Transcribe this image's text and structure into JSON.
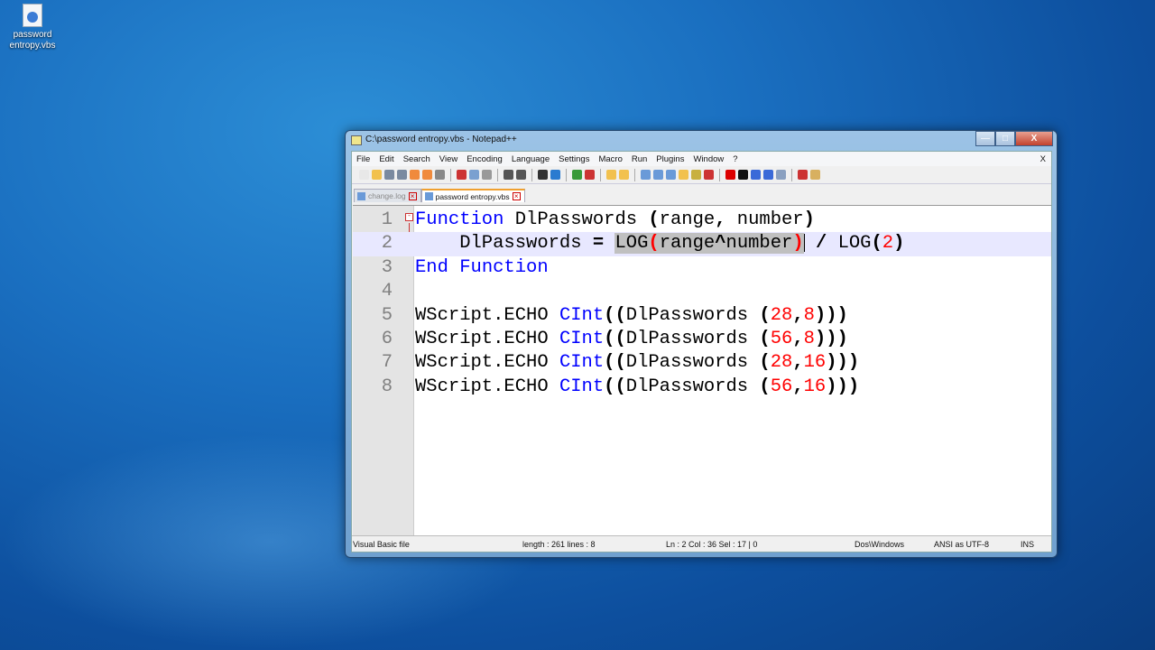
{
  "desktop": {
    "icons": [
      {
        "label_line1": "password",
        "label_line2": "entropy.vbs"
      }
    ]
  },
  "window": {
    "title": "C:\\password entropy.vbs - Notepad++",
    "minimize": "—",
    "maximize": "□",
    "close": "X"
  },
  "menu": [
    "File",
    "Edit",
    "Search",
    "View",
    "Encoding",
    "Language",
    "Settings",
    "Macro",
    "Run",
    "Plugins",
    "Window",
    "?"
  ],
  "menu_close": "X",
  "tabs": [
    {
      "label": "change.log",
      "active": false
    },
    {
      "label": "password entropy.vbs",
      "active": true
    }
  ],
  "code": [
    {
      "n": "1",
      "tokens": [
        [
          "Function",
          "kw"
        ],
        [
          " DlPasswords ",
          ""
        ],
        [
          "(",
          "op"
        ],
        [
          "range",
          ""
        ],
        [
          ",",
          "op"
        ],
        [
          " number",
          ""
        ],
        [
          ")",
          "op"
        ]
      ]
    },
    {
      "n": "2",
      "tokens": [
        [
          "    DlPasswords ",
          ""
        ],
        [
          "=",
          "op"
        ],
        [
          " ",
          ""
        ],
        [
          "LOG",
          "sel"
        ],
        [
          "(",
          "sel brace"
        ],
        [
          "range",
          "sel"
        ],
        [
          "^",
          "sel op"
        ],
        [
          "number",
          "sel"
        ],
        [
          ")",
          "sel brace"
        ],
        [
          "|",
          "caret"
        ],
        [
          " ",
          ""
        ],
        [
          "/",
          "op"
        ],
        [
          " LOG",
          ""
        ],
        [
          "(",
          "op"
        ],
        [
          "2",
          "num"
        ],
        [
          ")",
          "op"
        ]
      ]
    },
    {
      "n": "3",
      "tokens": [
        [
          "End",
          "kw"
        ],
        [
          " ",
          ""
        ],
        [
          "Function",
          "kw"
        ]
      ]
    },
    {
      "n": "4",
      "tokens": []
    },
    {
      "n": "5",
      "tokens": [
        [
          "WScript.ECHO ",
          ""
        ],
        [
          "CInt",
          "kw"
        ],
        [
          "((",
          "op"
        ],
        [
          "DlPasswords ",
          ""
        ],
        [
          "(",
          "op"
        ],
        [
          "28",
          "num"
        ],
        [
          ",",
          "op"
        ],
        [
          "8",
          "num"
        ],
        [
          ")))",
          "op"
        ]
      ]
    },
    {
      "n": "6",
      "tokens": [
        [
          "WScript.ECHO ",
          ""
        ],
        [
          "CInt",
          "kw"
        ],
        [
          "((",
          "op"
        ],
        [
          "DlPasswords ",
          ""
        ],
        [
          "(",
          "op"
        ],
        [
          "56",
          "num"
        ],
        [
          ",",
          "op"
        ],
        [
          "8",
          "num"
        ],
        [
          ")))",
          "op"
        ]
      ]
    },
    {
      "n": "7",
      "tokens": [
        [
          "WScript.ECHO ",
          ""
        ],
        [
          "CInt",
          "kw"
        ],
        [
          "((",
          "op"
        ],
        [
          "DlPasswords ",
          ""
        ],
        [
          "(",
          "op"
        ],
        [
          "28",
          "num"
        ],
        [
          ",",
          "op"
        ],
        [
          "16",
          "num"
        ],
        [
          ")))",
          "op"
        ]
      ]
    },
    {
      "n": "8",
      "tokens": [
        [
          "WScript.ECHO ",
          ""
        ],
        [
          "CInt",
          "kw"
        ],
        [
          "((",
          "op"
        ],
        [
          "DlPasswords ",
          ""
        ],
        [
          "(",
          "op"
        ],
        [
          "56",
          "num"
        ],
        [
          ",",
          "op"
        ],
        [
          "16",
          "num"
        ],
        [
          ")))",
          "op"
        ]
      ]
    }
  ],
  "current_line": 2,
  "status": {
    "filetype": "Visual Basic file",
    "length": "length : 261    lines : 8",
    "position": "Ln : 2    Col : 36    Sel : 17 | 0",
    "eol": "Dos\\Windows",
    "encoding": "ANSI as UTF-8",
    "mode": "INS"
  }
}
